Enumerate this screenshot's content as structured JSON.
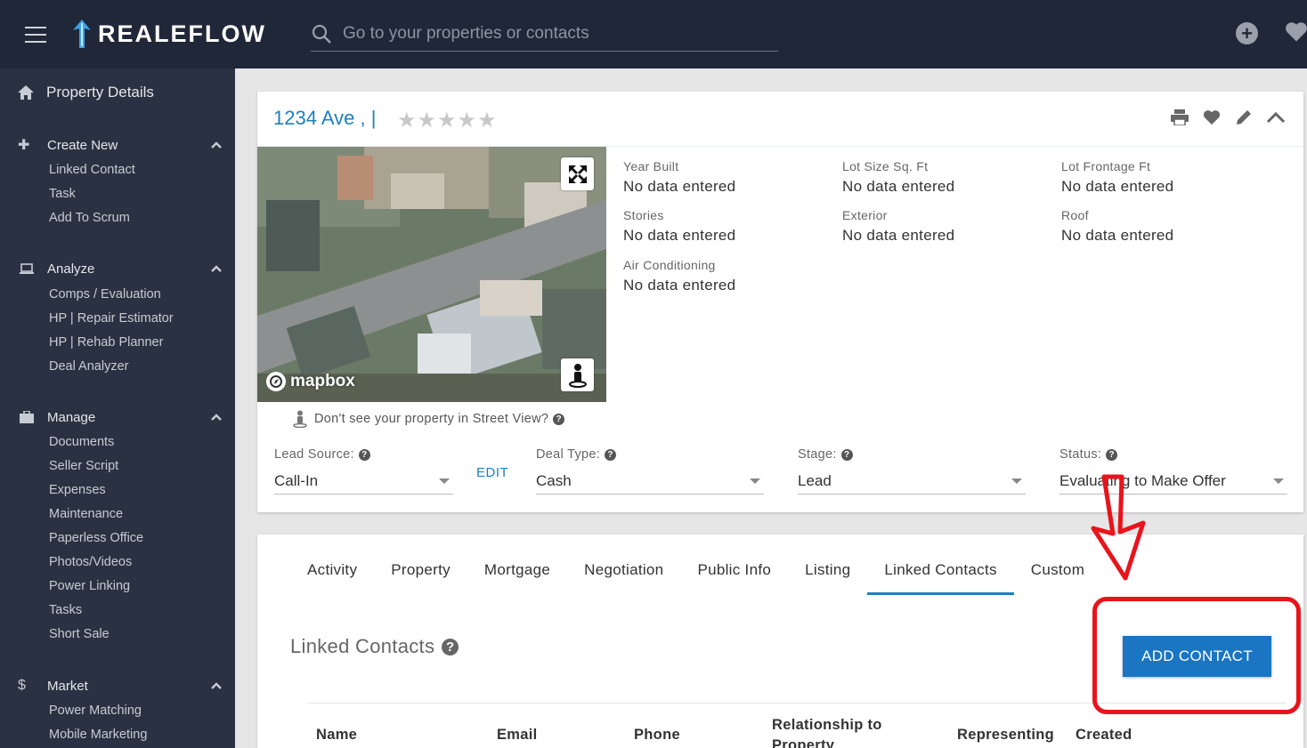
{
  "header": {
    "brand": "REALEFLOW",
    "search_placeholder": "Go to your properties or contacts"
  },
  "sidebar": {
    "top_item": "Property Details",
    "sections": [
      {
        "title": "Create New",
        "icon": "plus-icon",
        "items": [
          "Linked Contact",
          "Task",
          "Add To Scrum"
        ]
      },
      {
        "title": "Analyze",
        "icon": "laptop-icon",
        "items": [
          "Comps / Evaluation",
          "HP | Repair Estimator",
          "HP | Rehab Planner",
          "Deal Analyzer"
        ]
      },
      {
        "title": "Manage",
        "icon": "briefcase-icon",
        "items": [
          "Documents",
          "Seller Script",
          "Expenses",
          "Maintenance",
          "Paperless Office",
          "Photos/Videos",
          "Power Linking",
          "Tasks",
          "Short Sale"
        ]
      },
      {
        "title": "Market",
        "icon": "dollar-icon",
        "items": [
          "Power Matching",
          "Mobile Marketing"
        ]
      }
    ]
  },
  "property": {
    "address": "1234 Ave ,  |",
    "rating": 0,
    "map_brand": "mapbox",
    "attributes": [
      {
        "label": "Year Built",
        "value": "No data entered"
      },
      {
        "label": "Lot Size Sq. Ft",
        "value": "No data entered"
      },
      {
        "label": "Lot Frontage Ft",
        "value": "No data entered"
      },
      {
        "label": "Stories",
        "value": "No data entered"
      },
      {
        "label": "Exterior",
        "value": "No data entered"
      },
      {
        "label": "Roof",
        "value": "No data entered"
      },
      {
        "label": "Air Conditioning",
        "value": "No data entered"
      }
    ],
    "street_view_note": "Don't see your property in Street View?",
    "lead_source": {
      "label": "Lead Source:",
      "value": "Call-In"
    },
    "edit_label": "EDIT",
    "deal_type": {
      "label": "Deal Type:",
      "value": "Cash"
    },
    "stage": {
      "label": "Stage:",
      "value": "Lead"
    },
    "status": {
      "label": "Status:",
      "value": "Evaluating to Make Offer"
    }
  },
  "tabs": [
    "Activity",
    "Property",
    "Mortgage",
    "Negotiation",
    "Public Info",
    "Listing",
    "Linked Contacts",
    "Custom"
  ],
  "active_tab": "Linked Contacts",
  "linked_contacts": {
    "title": "Linked Contacts",
    "add_button": "ADD CONTACT",
    "columns": [
      "Name",
      "Email",
      "Phone",
      "Relationship to Property",
      "Representing",
      "Created"
    ]
  },
  "colors": {
    "topbar": "#1f2738",
    "sidebar": "#2a3142",
    "accent": "#1d7fc1",
    "annotation": "#e8141c"
  }
}
